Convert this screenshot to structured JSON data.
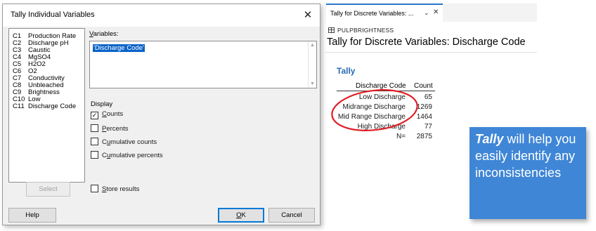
{
  "dialog": {
    "title": "Tally Individual Variables",
    "close_glyph": "✕",
    "columns": [
      {
        "code": "C1",
        "name": "Production Rate"
      },
      {
        "code": "C2",
        "name": "Discharge pH"
      },
      {
        "code": "C3",
        "name": "Caustic"
      },
      {
        "code": "C4",
        "name": "MgSO4"
      },
      {
        "code": "C5",
        "name": "H2O2"
      },
      {
        "code": "C6",
        "name": "O2"
      },
      {
        "code": "C7",
        "name": "Conductivity"
      },
      {
        "code": "C8",
        "name": "Unbleached"
      },
      {
        "code": "C9",
        "name": "Brightness"
      },
      {
        "code": "C10",
        "name": "Low"
      },
      {
        "code": "C11",
        "name": "Discharge Code"
      }
    ],
    "variables_label": "Variables:",
    "variables_value": "'Discharge Code'",
    "display_label": "Display",
    "options": [
      {
        "label": "Counts",
        "checked": true
      },
      {
        "label": "Percents",
        "checked": false
      },
      {
        "label": "Cumulative counts",
        "checked": false
      },
      {
        "label": "Cumulative percents",
        "checked": false
      }
    ],
    "store_results_label": "Store results",
    "select_button": "Select",
    "help_button": "Help",
    "ok_button": "OK",
    "cancel_button": "Cancel",
    "check_glyph": "✓"
  },
  "output": {
    "tab_title": "Tally for Discrete Variables: ...",
    "tab_chevron": "⌄",
    "tab_close": "✕",
    "worksheet": "PULPBRIGHTNESS",
    "title": "Tally for Discrete Variables: Discharge Code",
    "section": "Tally",
    "header_code": "Discharge Code",
    "header_count": "Count",
    "rows": [
      {
        "code": "Low Discharge",
        "count": "65"
      },
      {
        "code": "Midrange Discharge",
        "count": "1269"
      },
      {
        "code": "Mid Range Discharge",
        "count": "1464"
      },
      {
        "code": "High Discharge",
        "count": "77"
      }
    ],
    "total_label": "N=",
    "total_value": "2875",
    "highlight_color": "#e01f26"
  },
  "callout": {
    "bold": "Tally",
    "rest": " will help you easily identify any inconsistencies",
    "color": "#3f86d6"
  }
}
